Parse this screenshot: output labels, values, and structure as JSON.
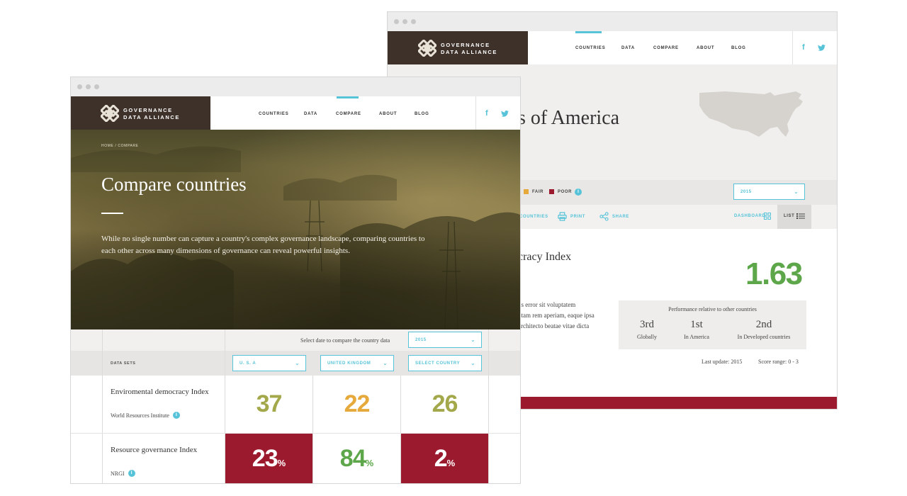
{
  "colors": {
    "brand_dark": "#3d3129",
    "accent_cyan": "#56c3d8",
    "good_green": "#5da74a",
    "olive": "#a3a84a",
    "amber": "#e6a93b",
    "poor_red": "#9b1a2e"
  },
  "brand": {
    "line1": "GOVERNANCE",
    "line2": "DATA ALLIANCE"
  },
  "nav": {
    "items": [
      "COUNTRIES",
      "DATA",
      "COMPARE",
      "ABOUT",
      "BLOG"
    ],
    "active_back": "COUNTRIES",
    "active_front": "COMPARE"
  },
  "social": {
    "facebook": "f",
    "twitter_icon": "twitter-icon"
  },
  "back": {
    "country_title": "s of America",
    "legend": [
      {
        "label": "FAIR",
        "color": "#e6a93b"
      },
      {
        "label": "POOR",
        "color": "#9b1a2e"
      }
    ],
    "year_select": "2015",
    "tools": {
      "countries": "COUNTRIES",
      "print": "PRINT",
      "share": "SHARE",
      "dashboard": "DASHBOARD",
      "list": "LIST"
    },
    "index_title": "cracy Index",
    "lorem_lines": [
      "us error sit voluptatem",
      "otam rem aperiam, eaque ipsa",
      "architecto beatae vitae dicta"
    ],
    "score": "1.63",
    "performance": {
      "heading": "Performance relative to other countries",
      "ranks": [
        {
          "rank": "3rd",
          "label": "Globally"
        },
        {
          "rank": "1st",
          "label": "In America"
        },
        {
          "rank": "2nd",
          "label": "In Developed countries"
        }
      ]
    },
    "last_update": "Last update: 2015",
    "score_range": "Score range: 0 - 3"
  },
  "front": {
    "breadcrumb": "HOME / COMPARE",
    "title": "Compare countries",
    "description": "While no single number can capture a country's complex governance landscape, comparing countries to each other across many dimensions of governance can reveal powerful insights.",
    "date_label": "Select date to compare the country data",
    "date_value": "2015",
    "data_sets_label": "DATA SETS",
    "country_selects": [
      "U. S. A",
      "UNITED KINGDOM",
      "SELECT COUNTRY"
    ],
    "rows": [
      {
        "name": "Enviromental democracy Index",
        "source": "World Resources Institute",
        "values": [
          "37",
          "22",
          "26"
        ],
        "suffix": ""
      },
      {
        "name": "Resource governance Index",
        "source": "NRGI",
        "values": [
          "23",
          "84",
          "2"
        ],
        "suffix": "%"
      }
    ]
  }
}
